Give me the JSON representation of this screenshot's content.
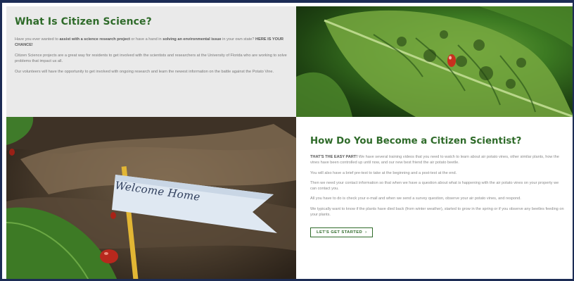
{
  "intro": {
    "title": "What Is Citizen Science?",
    "p1_pre": "Have you ever wanted to ",
    "p1_b1": "assist with a science research project",
    "p1_mid": " or have a hand in ",
    "p1_b2": "solving an environmental issue",
    "p1_post": " in your own state? ",
    "p1_b3": "HERE IS YOUR CHANCE!",
    "p2": "Citizen Science projects are a great way for residents to get involved with the scientists and researchers at the University of Florida who are working to solve problems that impact us all.",
    "p3": "Our volunteers will have the opportunity to get involved with ongoing research and learn the newest information on the battle against the Potato Vine."
  },
  "become": {
    "title": "How Do You Become a Citizen Scientist?",
    "p1_b": "THAT'S THE EASY PART!",
    "p1": " We have several training videos that you need to watch to learn about air potato vines, other similar plants, how the vines have been controlled up until now, and our new best friend the air potato beetle.",
    "p2": "You will also have a brief pre-test to take at the beginning and a post-test at the end.",
    "p3": "Then we need your contact information so that when we have a question about what is happening with the air potato vines on your property we can contact you.",
    "p4": "All you have to do is check your e-mail and when we send a survey question, observe your air potato vines, and respond.",
    "p5": "We typically want to know if the plants have died back (from winter weather), started to grow in the spring or if you observe any beetles feeding on your plants.",
    "cta_label": "LET'S GET STARTED",
    "cta_icon": "chevron-right-icon"
  },
  "images": {
    "welcome_flag_text": "Welcome Home"
  },
  "colors": {
    "accent_green": "#2f6b2a",
    "panel_gray": "#eaeaea",
    "frame_navy": "#1c2c55"
  }
}
